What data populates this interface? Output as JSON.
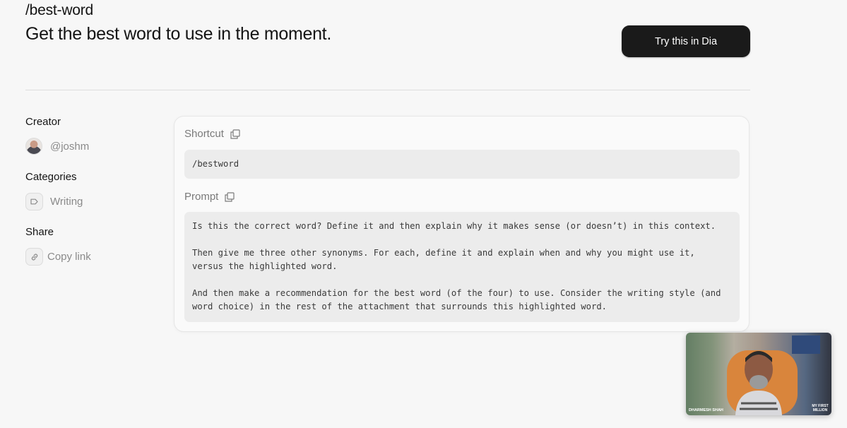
{
  "page": {
    "title": "/best-word",
    "subtitle": "Get the best word to use in the moment.",
    "try_button": "Try this in Dia"
  },
  "sidebar": {
    "creator_heading": "Creator",
    "creator_handle": "@joshm",
    "categories_heading": "Categories",
    "category": "Writing",
    "share_heading": "Share",
    "copy_link": "Copy link"
  },
  "card": {
    "shortcut_label": "Shortcut",
    "shortcut_value": "/bestword",
    "prompt_label": "Prompt",
    "prompt_paragraphs": [
      "Is this the correct word? Define it and then explain why it makes sense (or doesn’t) in this context.",
      "Then give me three other synonyms. For each, define it and explain when and why you might use it,\nversus the highlighted word.",
      "And then make a recommendation for the best word (of the four) to use. Consider the writing style (and\nword choice) in the rest of the attachment that surrounds this highlighted word."
    ]
  },
  "video_overlay": {
    "caption_left": "DHARMESH SHAH",
    "caption_right": "MY FIRST MILLION"
  },
  "colors": {
    "background": "#f7f7f7",
    "button_bg": "#1a1a1a",
    "code_bg": "#ececec"
  }
}
